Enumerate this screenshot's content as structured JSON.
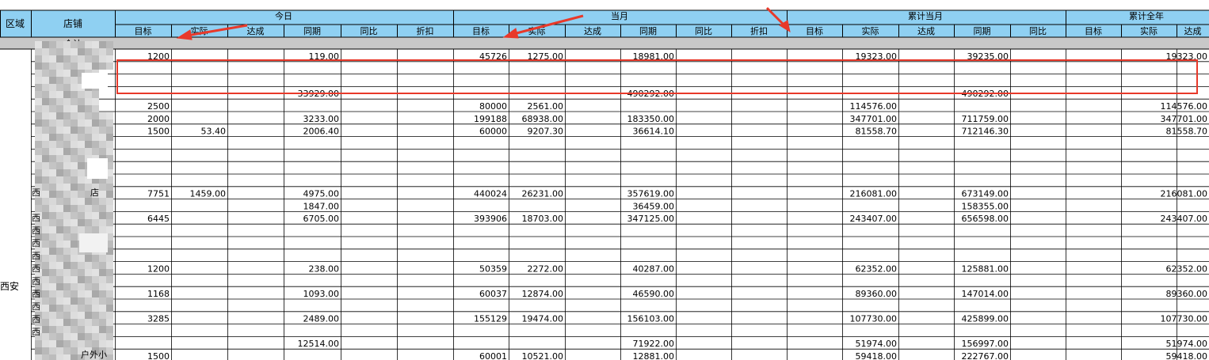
{
  "header": {
    "region_col": "区域",
    "store_col": "店铺",
    "groups": [
      "今日",
      "当月",
      "累计当月",
      "累计全年"
    ],
    "subcols_today": [
      "目标",
      "实际",
      "达成",
      "同期",
      "同比",
      "折扣"
    ],
    "subcols_month": [
      "目标",
      "实际",
      "达成",
      "同期",
      "同比",
      "折扣"
    ],
    "subcols_cum_month": [
      "目标",
      "实际",
      "达成",
      "同期",
      "同比"
    ],
    "subcols_year": [
      "目标",
      "实际",
      "达成"
    ]
  },
  "summary_label": "合计",
  "region_label": "西安",
  "store_fragments": [
    "西",
    "店",
    "西",
    "西",
    "西",
    "西",
    "西",
    "西",
    "西",
    "西",
    "西",
    "西",
    "户外小"
  ],
  "rows": [
    {
      "t_target": "1200",
      "t_actual": "",
      "t_ly": "119.00",
      "m_target": "45726",
      "m_actual": "1275.00",
      "m_ly": "18981.00",
      "c_actual": "19323.00",
      "c_ly": "39235.00",
      "y_actual": "19323.00"
    },
    {
      "t_target": "",
      "t_actual": "",
      "t_ly": "",
      "m_target": "",
      "m_actual": "",
      "m_ly": "",
      "c_actual": "",
      "c_ly": "",
      "y_actual": ""
    },
    {
      "t_target": "",
      "t_actual": "",
      "t_ly": "",
      "m_target": "",
      "m_actual": "",
      "m_ly": "",
      "c_actual": "",
      "c_ly": "",
      "y_actual": ""
    },
    {
      "t_target": "",
      "t_actual": "",
      "t_ly": "33929.00",
      "m_target": "",
      "m_actual": "",
      "m_ly": "490292.00",
      "c_actual": "",
      "c_ly": "490292.00",
      "y_actual": ""
    },
    {
      "t_target": "2500",
      "t_actual": "",
      "t_ly": "",
      "m_target": "80000",
      "m_actual": "2561.00",
      "m_ly": "",
      "c_actual": "114576.00",
      "c_ly": "",
      "y_actual": "114576.00"
    },
    {
      "t_target": "2000",
      "t_actual": "",
      "t_ly": "3233.00",
      "m_target": "199188",
      "m_actual": "68938.00",
      "m_ly": "183350.00",
      "c_actual": "347701.00",
      "c_ly": "711759.00",
      "y_actual": "347701.00"
    },
    {
      "t_target": "1500",
      "t_actual": "53.40",
      "t_ly": "2006.40",
      "m_target": "60000",
      "m_actual": "9207.30",
      "m_ly": "36614.10",
      "c_actual": "81558.70",
      "c_ly": "712146.30",
      "y_actual": "81558.70"
    },
    {
      "t_target": "",
      "t_actual": "",
      "t_ly": "",
      "m_target": "",
      "m_actual": "",
      "m_ly": "",
      "c_actual": "",
      "c_ly": "",
      "y_actual": ""
    },
    {
      "t_target": "",
      "t_actual": "",
      "t_ly": "",
      "m_target": "",
      "m_actual": "",
      "m_ly": "",
      "c_actual": "",
      "c_ly": "",
      "y_actual": ""
    },
    {
      "t_target": "",
      "t_actual": "",
      "t_ly": "",
      "m_target": "",
      "m_actual": "",
      "m_ly": "",
      "c_actual": "",
      "c_ly": "",
      "y_actual": ""
    },
    {
      "t_target": "",
      "t_actual": "",
      "t_ly": "",
      "m_target": "",
      "m_actual": "",
      "m_ly": "",
      "c_actual": "",
      "c_ly": "",
      "y_actual": ""
    },
    {
      "t_target": "7751",
      "t_actual": "1459.00",
      "t_ly": "4975.00",
      "m_target": "440024",
      "m_actual": "26231.00",
      "m_ly": "357619.00",
      "c_actual": "216081.00",
      "c_ly": "673149.00",
      "y_actual": "216081.00"
    },
    {
      "t_target": "",
      "t_actual": "",
      "t_ly": "1847.00",
      "m_target": "",
      "m_actual": "",
      "m_ly": "36459.00",
      "c_actual": "",
      "c_ly": "158355.00",
      "y_actual": ""
    },
    {
      "t_target": "6445",
      "t_actual": "",
      "t_ly": "6705.00",
      "m_target": "393906",
      "m_actual": "18703.00",
      "m_ly": "347125.00",
      "c_actual": "243407.00",
      "c_ly": "656598.00",
      "y_actual": "243407.00"
    },
    {
      "t_target": "",
      "t_actual": "",
      "t_ly": "",
      "m_target": "",
      "m_actual": "",
      "m_ly": "",
      "c_actual": "",
      "c_ly": "",
      "y_actual": ""
    },
    {
      "t_target": "",
      "t_actual": "",
      "t_ly": "",
      "m_target": "",
      "m_actual": "",
      "m_ly": "",
      "c_actual": "",
      "c_ly": "",
      "y_actual": ""
    },
    {
      "t_target": "",
      "t_actual": "",
      "t_ly": "",
      "m_target": "",
      "m_actual": "",
      "m_ly": "",
      "c_actual": "",
      "c_ly": "",
      "y_actual": ""
    },
    {
      "t_target": "1200",
      "t_actual": "",
      "t_ly": "238.00",
      "m_target": "50359",
      "m_actual": "2272.00",
      "m_ly": "40287.00",
      "c_actual": "62352.00",
      "c_ly": "125881.00",
      "y_actual": "62352.00"
    },
    {
      "t_target": "",
      "t_actual": "",
      "t_ly": "",
      "m_target": "",
      "m_actual": "",
      "m_ly": "",
      "c_actual": "",
      "c_ly": "",
      "y_actual": ""
    },
    {
      "t_target": "1168",
      "t_actual": "",
      "t_ly": "1093.00",
      "m_target": "60037",
      "m_actual": "12874.00",
      "m_ly": "46590.00",
      "c_actual": "89360.00",
      "c_ly": "147014.00",
      "y_actual": "89360.00"
    },
    {
      "t_target": "",
      "t_actual": "",
      "t_ly": "",
      "m_target": "",
      "m_actual": "",
      "m_ly": "",
      "c_actual": "",
      "c_ly": "",
      "y_actual": ""
    },
    {
      "t_target": "3285",
      "t_actual": "",
      "t_ly": "2489.00",
      "m_target": "155129",
      "m_actual": "19474.00",
      "m_ly": "156103.00",
      "c_actual": "107730.00",
      "c_ly": "425899.00",
      "y_actual": "107730.00"
    },
    {
      "t_target": "",
      "t_actual": "",
      "t_ly": "",
      "m_target": "",
      "m_actual": "",
      "m_ly": "",
      "c_actual": "",
      "c_ly": "",
      "y_actual": ""
    },
    {
      "t_target": "",
      "t_actual": "",
      "t_ly": "12514.00",
      "m_target": "",
      "m_actual": "",
      "m_ly": "71922.00",
      "c_actual": "51974.00",
      "c_ly": "156997.00",
      "y_actual": "51974.00"
    },
    {
      "t_target": "1500",
      "t_actual": "",
      "t_ly": "",
      "m_target": "60001",
      "m_actual": "10521.00",
      "m_ly": "12881.00",
      "c_actual": "59418.00",
      "c_ly": "222767.00",
      "y_actual": "59418.00"
    }
  ],
  "annotations": {
    "arrow_color": "#e8392a",
    "highlight_box_color": "#e8392a"
  }
}
